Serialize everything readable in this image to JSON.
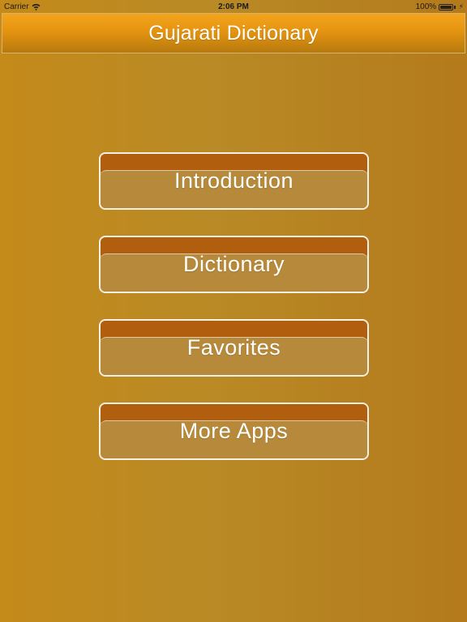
{
  "status_bar": {
    "carrier": "Carrier",
    "time": "2:06 PM",
    "battery_text": "100%",
    "battery_level": 1.0
  },
  "nav": {
    "title": "Gujarati Dictionary"
  },
  "menu": {
    "items": [
      {
        "label": "Introduction"
      },
      {
        "label": "Dictionary"
      },
      {
        "label": "Favorites"
      },
      {
        "label": "More Apps"
      }
    ]
  },
  "colors": {
    "background": "#b98a26",
    "nav_bar": "#e59410",
    "button_band": "#b15f0f",
    "button_panel": "#b68a3a",
    "button_border": "#f4f0e6",
    "text": "#ffffff"
  }
}
